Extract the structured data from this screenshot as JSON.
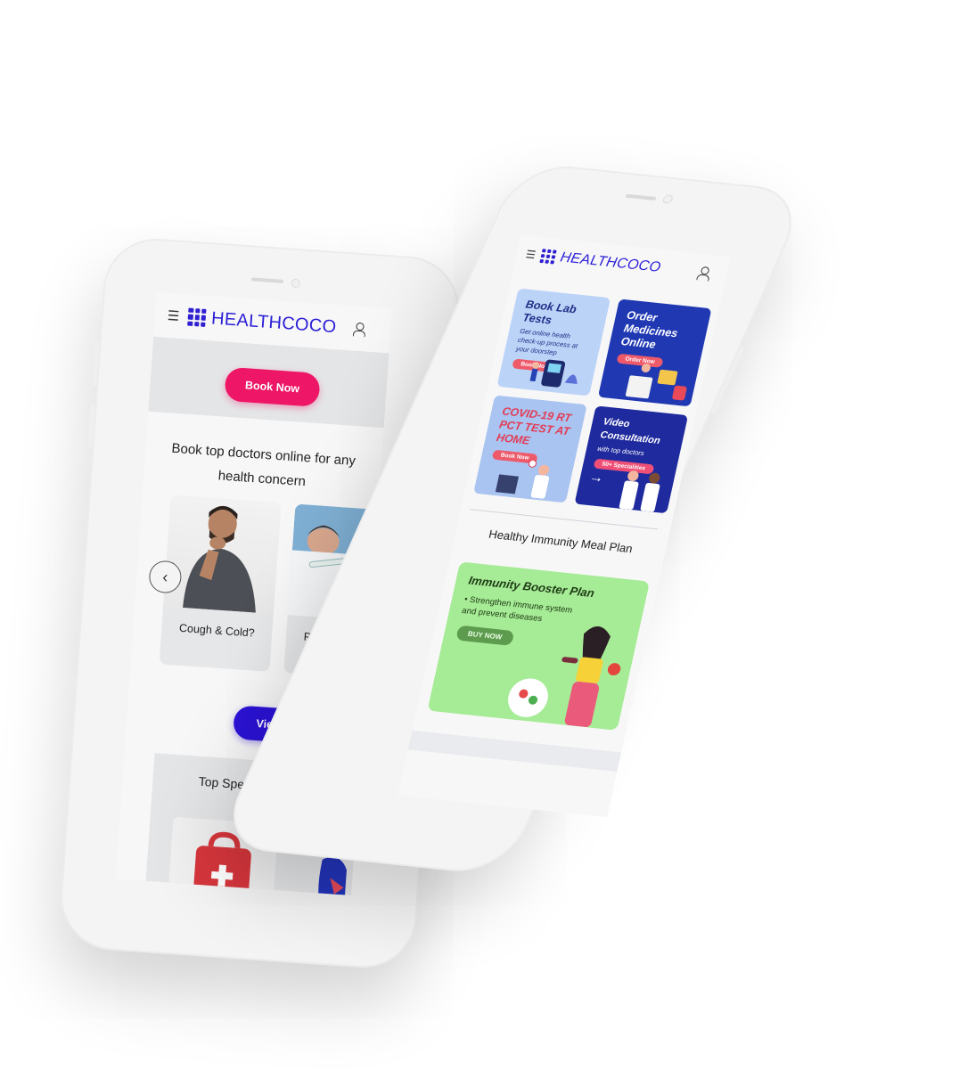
{
  "brand": {
    "name": "HEALTHCOCO"
  },
  "left": {
    "book_now_label": "Book Now",
    "headline": "Book top doctors online for any health concern",
    "cards": [
      {
        "label": "Cough & Cold?"
      },
      {
        "label": "Period problem"
      }
    ],
    "view_all_label": "View All",
    "specialities_title": "Top Specialities"
  },
  "right": {
    "tiles": [
      {
        "title": "Book Lab Tests",
        "subtitle": "Get online health check-up process at your doorstep",
        "cta": "Book Now"
      },
      {
        "title": "Order Medicines Online",
        "cta": "Order Now"
      },
      {
        "title": "COVID-19 RT PCT TEST AT HOME",
        "cta": "Book Now"
      },
      {
        "title": "Video Consultation",
        "subtitle": "with top doctors",
        "cta": "50+ Specialities"
      }
    ],
    "meal_section_title": "Healthy Immunity Meal Plan",
    "meal_card": {
      "title": "Immunity Booster Plan",
      "text": "• Strengthen immune system and prevent diseases",
      "cta": "BUY NOW"
    }
  },
  "colors": {
    "brand": "#2b1ed6",
    "book_now": "#ee1666",
    "view_all": "#2b12d6",
    "tile_lab": "#bcd3f8",
    "tile_medicine": "#2039b3",
    "tile_covid": "#a9c4f1",
    "tile_video": "#1f2a9e",
    "meal": "#a6eb95"
  },
  "icons": [
    "hamburger-icon",
    "logo-grid-icon",
    "user-icon",
    "chevron-left-icon",
    "chevron-right-icon"
  ]
}
